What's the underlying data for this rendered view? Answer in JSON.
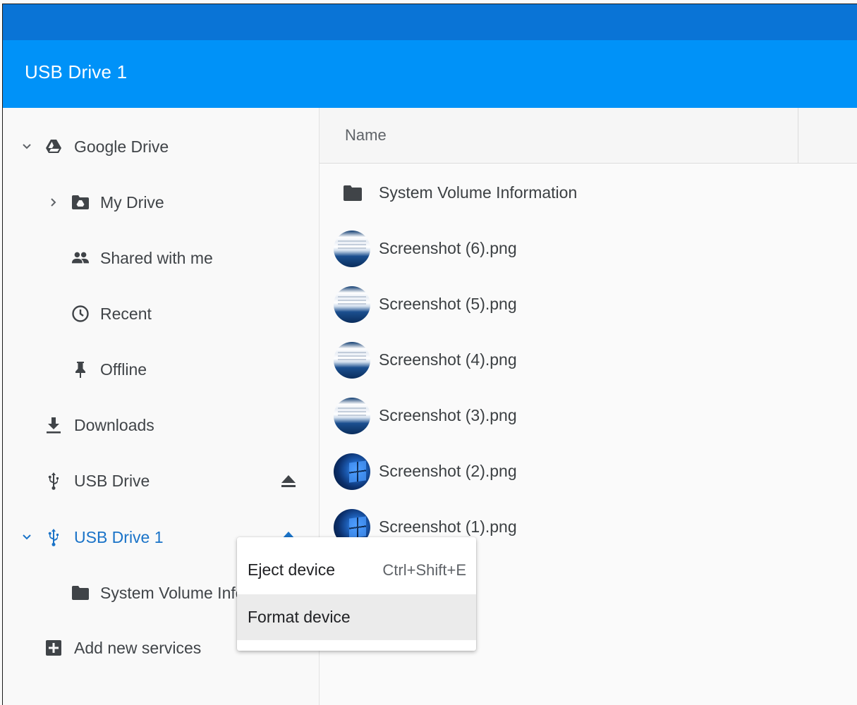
{
  "app": {
    "title": "USB Drive 1"
  },
  "colors": {
    "titlebar": "#0a74d6",
    "appbar": "#0092f8",
    "accent": "#1a73c8"
  },
  "sidebar": {
    "items": [
      {
        "label": "Google Drive",
        "icon": "google-drive-icon",
        "expander": "expanded"
      },
      {
        "label": "My Drive",
        "icon": "my-drive-folder-icon",
        "expander": "collapsed"
      },
      {
        "label": "Shared with me",
        "icon": "people-icon"
      },
      {
        "label": "Recent",
        "icon": "clock-icon"
      },
      {
        "label": "Offline",
        "icon": "pin-icon"
      },
      {
        "label": "Downloads",
        "icon": "download-icon"
      },
      {
        "label": "USB Drive",
        "icon": "usb-icon",
        "eject": "eject-icon"
      },
      {
        "label": "USB Drive 1",
        "icon": "usb-icon",
        "expander": "expanded",
        "eject": "eject-icon",
        "selected": true
      },
      {
        "label": "System Volume Information",
        "icon": "folder-icon"
      },
      {
        "label": "Add new services",
        "icon": "add-box-icon"
      }
    ]
  },
  "filelist": {
    "column_name": "Name",
    "files": [
      {
        "name": "System Volume Information",
        "type": "folder"
      },
      {
        "name": "Screenshot (6).png",
        "type": "image"
      },
      {
        "name": "Screenshot (5).png",
        "type": "image"
      },
      {
        "name": "Screenshot (4).png",
        "type": "image"
      },
      {
        "name": "Screenshot (3).png",
        "type": "image"
      },
      {
        "name": "Screenshot (2).png",
        "type": "image"
      },
      {
        "name": "Screenshot (1).png",
        "type": "image"
      }
    ]
  },
  "context_menu": {
    "items": [
      {
        "label": "Eject device",
        "shortcut": "Ctrl+Shift+E"
      },
      {
        "label": "Format device",
        "shortcut": "",
        "highlighted": true
      }
    ]
  }
}
